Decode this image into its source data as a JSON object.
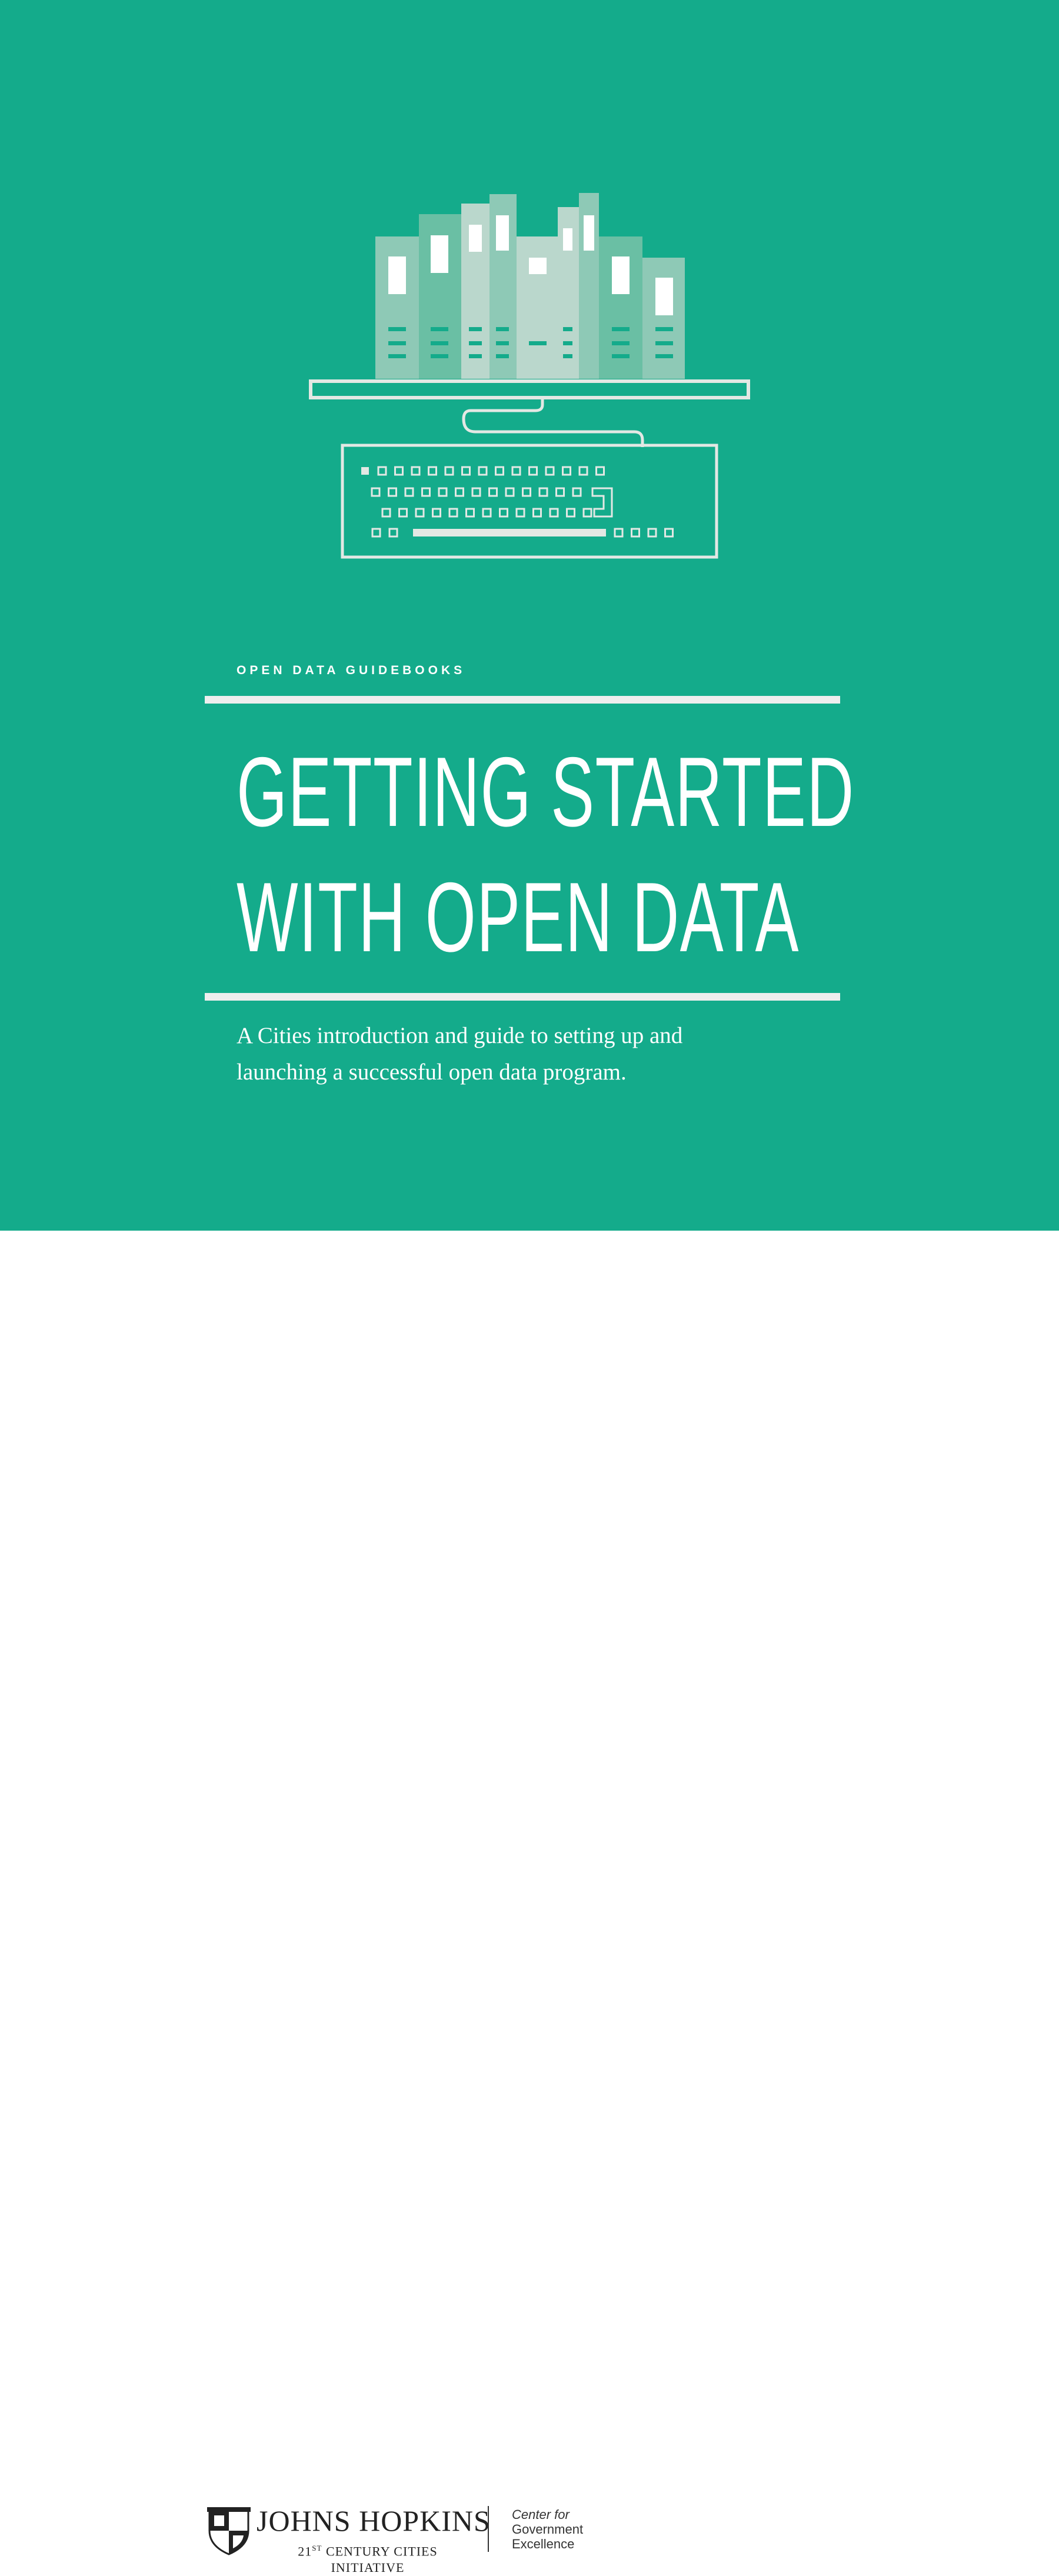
{
  "cover": {
    "background_color": "#14ab8b",
    "illustration": "books-on-computer-keyboard-icon",
    "eyebrow": "OPEN DATA GUIDEBOOKS",
    "title_lines": [
      "GETTING STARTED",
      "WITH OPEN DATA"
    ],
    "subtitle_lines": [
      "A Cities introduction and guide to setting up and",
      "launching a successful open data program."
    ]
  },
  "footer": {
    "jh_logo": {
      "name": "JOHNS HOPKINS",
      "sub_num": "21",
      "sub_sup": "ST",
      "sub_line1_rest": " CENTURY CITIES",
      "sub_line2": "INITIATIVE",
      "icon": "shield-icon"
    },
    "cge_logo": {
      "line1": "Center for",
      "line2": "Government",
      "line3": "Excellence"
    }
  }
}
